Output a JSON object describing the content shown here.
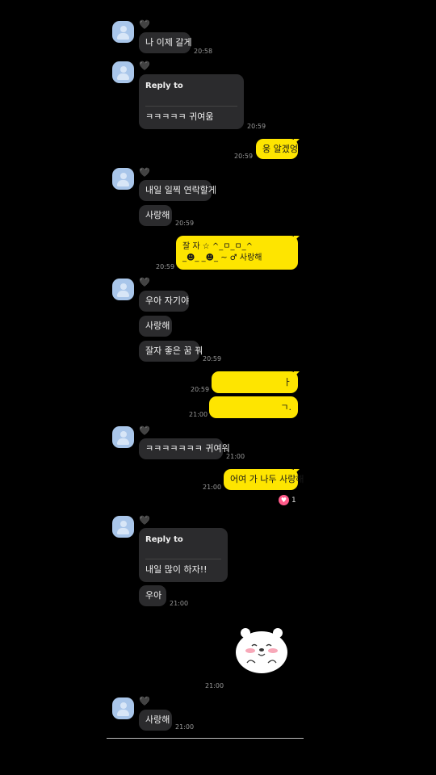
{
  "heart_glyph": "🖤",
  "messages": [
    {
      "text": "나 이제 갈게",
      "time": "20:58"
    },
    {
      "reply_label": "Reply to",
      "text": "ㅋㅋㅋㅋㅋ 귀여움",
      "time": "20:59"
    },
    {
      "text": "웅 알겠엉",
      "time": "20:59"
    },
    {
      "text": "내일 일찍 연락할게"
    },
    {
      "text": "사랑해",
      "time": "20:59"
    },
    {
      "line1": "잘 자 ☆ ^_ㅁ_ㅁ_^",
      "line2": "_☻_ _☻_ ~ ♂ 사랑해",
      "time": "20:59"
    },
    {
      "text": "우아 자기야"
    },
    {
      "text": "사랑해"
    },
    {
      "text": "잘자 좋은 꿈 꿔",
      "time": "20:59"
    },
    {
      "text": "ㅏ",
      "time": "20:59"
    },
    {
      "text": "ㄱ.",
      "time": "21:00"
    },
    {
      "text": "ㅋㅋㅋㅋㅋㅋㅋ 귀여워",
      "time": "21:00"
    },
    {
      "text": "어여 가 나두 사랑해",
      "time": "21:00",
      "reaction_count": "1"
    },
    {
      "reply_label": "Reply to",
      "text": "내일 많이 하자!!"
    },
    {
      "text": "우아",
      "time": "21:00"
    },
    {
      "time": "21:00"
    },
    {
      "text": "사랑해",
      "time": "21:00"
    }
  ]
}
